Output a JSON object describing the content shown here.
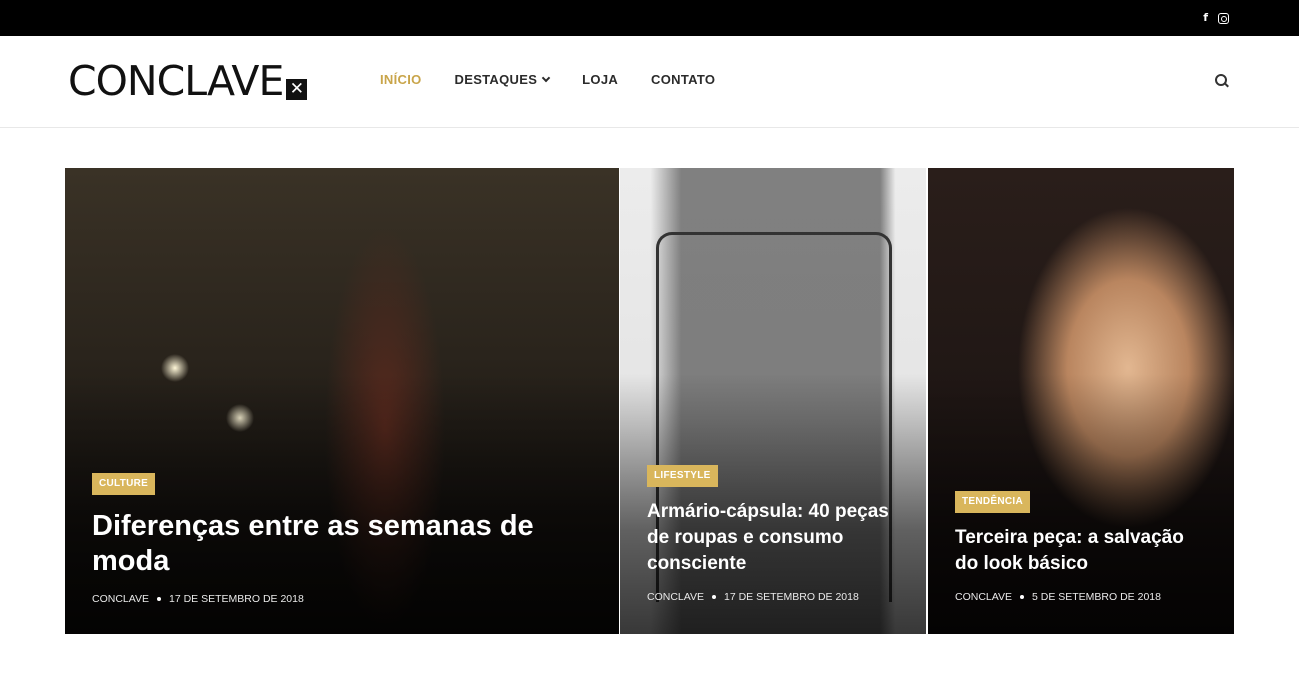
{
  "topbar": {
    "social": {
      "facebook_label": "f",
      "icons": [
        "facebook-icon",
        "instagram-icon"
      ]
    }
  },
  "header": {
    "logo_text": "CONCLAVE",
    "logo_mark": "✕",
    "nav": [
      {
        "label": "INÍCIO",
        "active": true
      },
      {
        "label": "DESTAQUES",
        "has_dropdown": true
      },
      {
        "label": "LOJA"
      },
      {
        "label": "CONTATO"
      }
    ],
    "search_icon": "search-icon"
  },
  "featured": [
    {
      "category": "CULTURE",
      "title": "Diferenças entre as semanas de moda",
      "author": "CONCLAVE",
      "date": "17 DE SETEMBRO DE 2018"
    },
    {
      "category": "LIFESTYLE",
      "title": "Armário-cápsula: 40 peças de roupas e consumo consciente",
      "author": "CONCLAVE",
      "date": "17 DE SETEMBRO DE 2018"
    },
    {
      "category": "TENDÊNCIA",
      "title": "Terceira peça: a salvação do look básico",
      "author": "CONCLAVE",
      "date": "5 DE SETEMBRO DE 2018"
    }
  ],
  "colors": {
    "accent": "#c9a54a",
    "badge": "#d9b65c",
    "topbar": "#000000"
  }
}
